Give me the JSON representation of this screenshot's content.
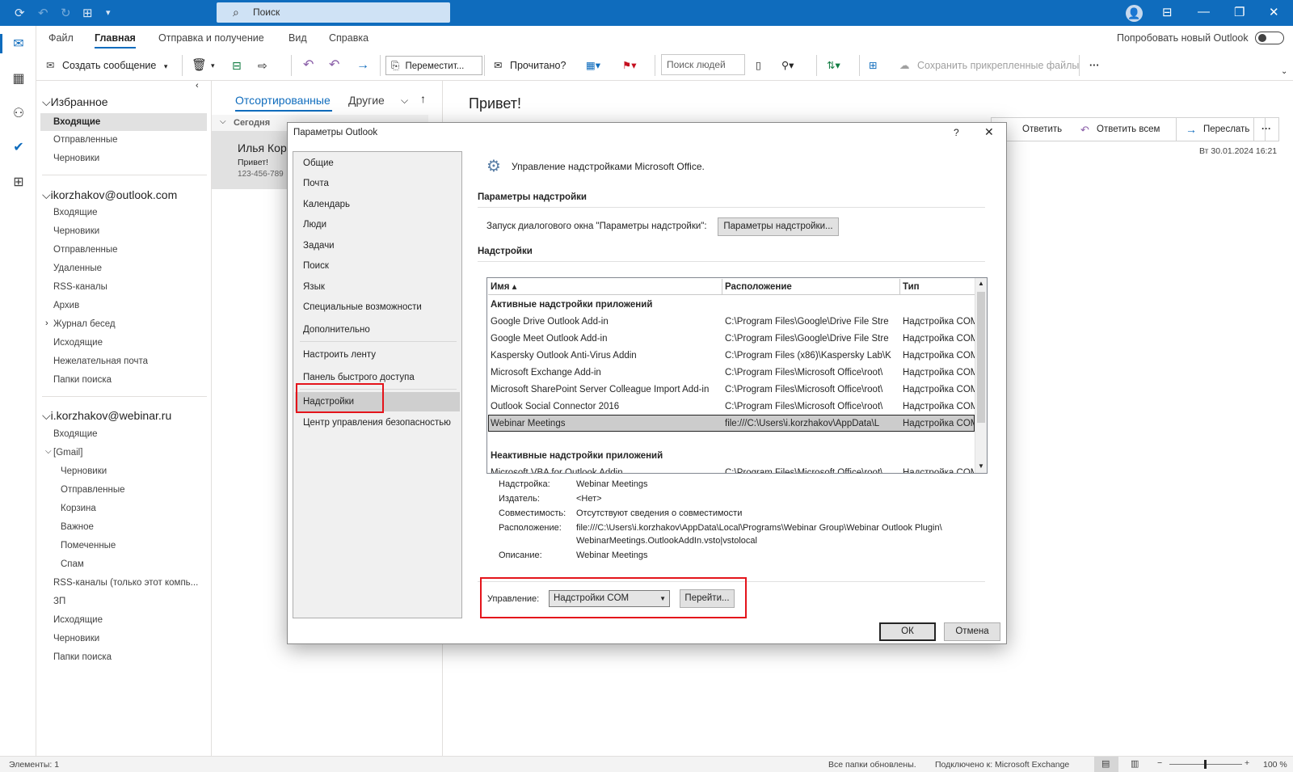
{
  "titlebar": {
    "search_placeholder": "Поиск"
  },
  "menu": {
    "tabs": [
      "Файл",
      "Главная",
      "Отправка и получение",
      "Вид",
      "Справка"
    ],
    "try_new": "Попробовать новый Outlook"
  },
  "ribbon": {
    "new_message": "Создать сообщение",
    "move": "Переместит...",
    "read": "Прочитано?",
    "people_search_placeholder": "Поиск людей",
    "save_attachments": "Сохранить прикрепленные файлы"
  },
  "folders": {
    "favorites": "Избранное",
    "fav_items": [
      "Входящие",
      "Отправленные",
      "Черновики"
    ],
    "acc1": "ikorzhakov@outlook.com",
    "acc1_items": [
      "Входящие",
      "Черновики",
      "Отправленные",
      "Удаленные",
      "RSS-каналы",
      "Архив",
      "Журнал бесед",
      "Исходящие",
      "Нежелательная почта",
      "Папки поиска"
    ],
    "acc2": "i.korzhakov@webinar.ru",
    "acc2_items": [
      "Входящие",
      "[Gmail]",
      "Черновики",
      "Отправленные",
      "Корзина",
      "Важное",
      "Помеченные",
      "Спам",
      "RSS-каналы (только этот компь...",
      "ЗП",
      "Исходящие",
      "Черновики",
      "Папки поиска"
    ]
  },
  "msglist": {
    "tab_sorted": "Отсортированные",
    "tab_other": "Другие",
    "group_today": "Сегодня",
    "msg_sender": "Илья Кор",
    "msg_subject": "Привет!",
    "msg_preview": "123-456-789"
  },
  "reading": {
    "subject": "Привет!",
    "reply": "Ответить",
    "reply_all": "Ответить всем",
    "forward": "Переслать",
    "date": "Вт 30.01.2024 16:21"
  },
  "dialog": {
    "title": "Параметры Outlook",
    "help": "?",
    "nav": [
      "Общие",
      "Почта",
      "Календарь",
      "Люди",
      "Задачи",
      "Поиск",
      "Язык",
      "Специальные возможности",
      "Дополнительно",
      "Настроить ленту",
      "Панель быстрого доступа",
      "Надстройки",
      "Центр управления безопасностью"
    ],
    "header": "Управление надстройками Microsoft Office.",
    "section_settings": "Параметры надстройки",
    "launch_label": "Запуск диалогового окна \"Параметры надстройки\":",
    "launch_button": "Параметры надстройки...",
    "section_addins": "Надстройки",
    "columns": [
      "Имя ▴",
      "Расположение",
      "Тип"
    ],
    "group_active": "Активные надстройки приложений",
    "rows": [
      {
        "name": "Google Drive Outlook Add-in",
        "location": "C:\\Program Files\\Google\\Drive File Stre",
        "type": "Надстройка COM"
      },
      {
        "name": "Google Meet Outlook Add-in",
        "location": "C:\\Program Files\\Google\\Drive File Stre",
        "type": "Надстройка COM"
      },
      {
        "name": "Kaspersky Outlook Anti-Virus Addin",
        "location": "C:\\Program Files (x86)\\Kaspersky Lab\\K",
        "type": "Надстройка COM"
      },
      {
        "name": "Microsoft Exchange Add-in",
        "location": "C:\\Program Files\\Microsoft Office\\root\\",
        "type": "Надстройка COM"
      },
      {
        "name": "Microsoft SharePoint Server Colleague Import Add-in",
        "location": "C:\\Program Files\\Microsoft Office\\root\\",
        "type": "Надстройка COM"
      },
      {
        "name": "Outlook Social Connector 2016",
        "location": "C:\\Program Files\\Microsoft Office\\root\\",
        "type": "Надстройка COM"
      },
      {
        "name": "Webinar Meetings",
        "location": "file:///C:\\Users\\i.korzhakov\\AppData\\L",
        "type": "Надстройка COM"
      }
    ],
    "group_inactive": "Неактивные надстройки приложений",
    "inactive_partial": {
      "name": "Microsoft VBA for Outlook Addin",
      "location": "C:\\Program Files\\Microsoft Office\\root\\",
      "type": "Надстройка COM"
    },
    "details": {
      "addin_label": "Надстройка:",
      "addin_value": "Webinar Meetings",
      "publisher_label": "Издатель:",
      "publisher_value": "<Нет>",
      "compat_label": "Совместимость:",
      "compat_value": "Отсутствуют сведения о совместимости",
      "location_label": "Расположение:",
      "location_value1": "file:///C:\\Users\\i.korzhakov\\AppData\\Local\\Programs\\Webinar Group\\Webinar Outlook Plugin\\",
      "location_value2": "WebinarMeetings.OutlookAddIn.vsto|vstolocal",
      "desc_label": "Описание:",
      "desc_value": "Webinar Meetings"
    },
    "manage_label": "Управление:",
    "manage_value": "Надстройки COM",
    "go_button": "Перейти...",
    "ok": "ОК",
    "cancel": "Отмена"
  },
  "status": {
    "items": "Элементы: 1",
    "updated": "Все папки обновлены.",
    "connected": "Подключено к: Microsoft Exchange",
    "zoom": "100 %"
  }
}
